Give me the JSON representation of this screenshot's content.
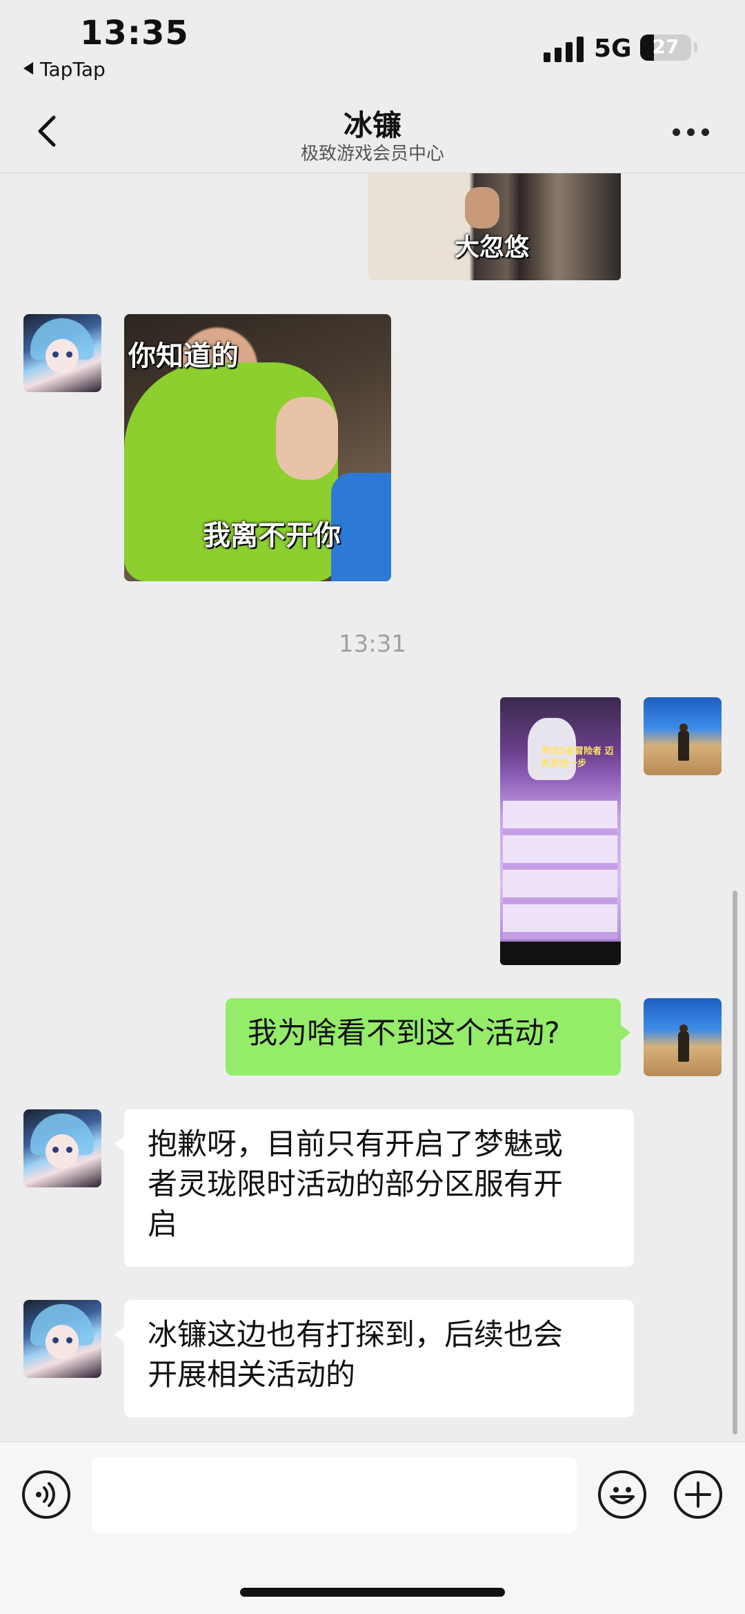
{
  "status_bar": {
    "time": "13:35",
    "back_app": "TapTap",
    "network": "5G",
    "battery": "27",
    "battery_level": 0.27
  },
  "header": {
    "title": "冰镰",
    "subtitle": "极致游戏会员中心",
    "back_icon": "chevron-left-icon",
    "more_icon": "more-dots-icon"
  },
  "messages": [
    {
      "type": "image",
      "from": "other",
      "caption": "大忽悠",
      "partial": true
    },
    {
      "type": "image",
      "from": "bot",
      "caption_top": "你知道的",
      "caption_bottom": "我离不开你"
    },
    {
      "type": "timestamp",
      "text": "13:31"
    },
    {
      "type": "image",
      "from": "me",
      "caption": "养成5星冒险者 迈断更进一步"
    },
    {
      "type": "text",
      "from": "me",
      "text": "我为啥看不到这个活动?"
    },
    {
      "type": "text",
      "from": "bot",
      "lines": [
        "抱歉呀，目前只有开启了梦魅或",
        "者灵珑限时活动的部分区服有开",
        "启"
      ]
    },
    {
      "type": "text",
      "from": "bot",
      "lines": [
        "冰镰这边也有打探到，后续也会",
        "开展相关活动的"
      ]
    }
  ],
  "input_bar": {
    "voice_icon": "voice-icon",
    "emoji_icon": "emoji-icon",
    "plus_icon": "plus-icon",
    "placeholder": ""
  },
  "colors": {
    "background": "#ededed",
    "my_bubble": "#95ec69",
    "bot_bubble": "#ffffff"
  }
}
